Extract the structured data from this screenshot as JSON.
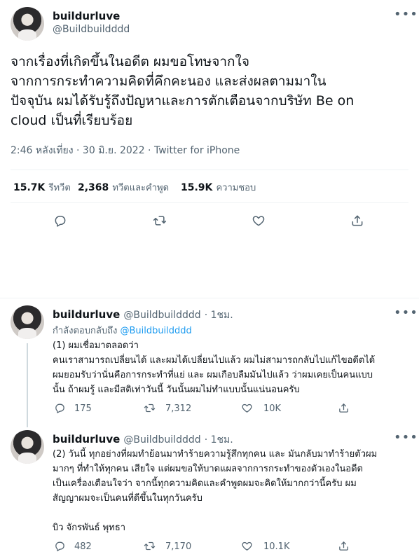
{
  "main_tweet": {
    "author_name": "buildurluve",
    "author_handle": "@Buildbuildddd",
    "text_lines": [
      "จากเรื่องที่เกิดขึ้นในอดีต ผมขอโทษจากใจ",
      "จากการกระทำความคิดที่คึกคะนอง และส่งผลตามมาใน",
      "ปัจจุบัน ผมได้รับรู้ถึงปัญหาและการตักเตือนจากบริษัท Be on",
      "cloud เป็นที่เรียบร้อย"
    ],
    "timestamp": "2:46 หลังเที่ยง · 30 มิ.ย. 2022 · Twitter for iPhone",
    "stats": {
      "retweets_count": "15.7K",
      "retweets_label": "รีทวีต",
      "quotes_count": "2,368",
      "quotes_label": "ทวีตและคำพูด",
      "likes_count": "15.9K",
      "likes_label": "ความชอบ"
    }
  },
  "replies": [
    {
      "author_name": "buildurluve",
      "author_handle": "@Buildbuildddd",
      "time": "· 1ชม.",
      "replying_prefix": "กำลังตอบกลับถึง",
      "replying_to": "@Buildbuildddd",
      "text_lines": [
        "(1) ผมเชื่อมาตลอดว่า",
        "คนเราสามารถเปลี่ยนได้ และผมได้เปลี่ยนไปแล้ว ผมไม่สามารถกลับไปแก้ไขอดีตได้",
        "ผมยอมรับว่านั่นคือการกระทำที่แย่ และ ผมเกือบลืมมันไปแล้ว ว่าผมเคยเป็นคนแบบ",
        "นั้น ถ้าผมรู้ และมีสติเท่าวันนี้ วันนั้นผมไม่ทำแบบนั้นแน่นอนครับ"
      ],
      "reply_count": "175",
      "retweet_count": "7,312",
      "like_count": "10K"
    },
    {
      "author_name": "buildurluve",
      "author_handle": "@Buildbuildddd",
      "time": "· 1ชม.",
      "text_lines": [
        "(2) วันนี้ ทุกอย่างที่ผมทำย้อนมาทำร้ายความรู้สึกทุกคน และ มันกลับมาทำร้ายตัวผม",
        "มากๆ ที่ทำให้ทุกคน เสียใจ แต่ผมขอให้บาดแผลจากการกระทำของตัวเองในอดีต",
        "เป็นเครื่องเตือนใจว่า จากนี้ทุกความคิดและคำพูดผมจะคิดให้มากกว่านี้ครับ ผม",
        "สัญญาผมจะเป็นคนที่ดีขึ้นในทุกวันครับ",
        "",
        "บิว จักรพันธ์ พุทธา"
      ],
      "reply_count": "482",
      "retweet_count": "7,170",
      "like_count": "10.1K"
    }
  ],
  "icons": {
    "more": "more-icon",
    "reply": "reply-icon",
    "retweet": "retweet-icon",
    "like": "heart-icon",
    "share": "share-icon"
  },
  "colors": {
    "accent": "#1d9bf0",
    "secondary_text": "#536471",
    "divider": "#eff3f4"
  }
}
